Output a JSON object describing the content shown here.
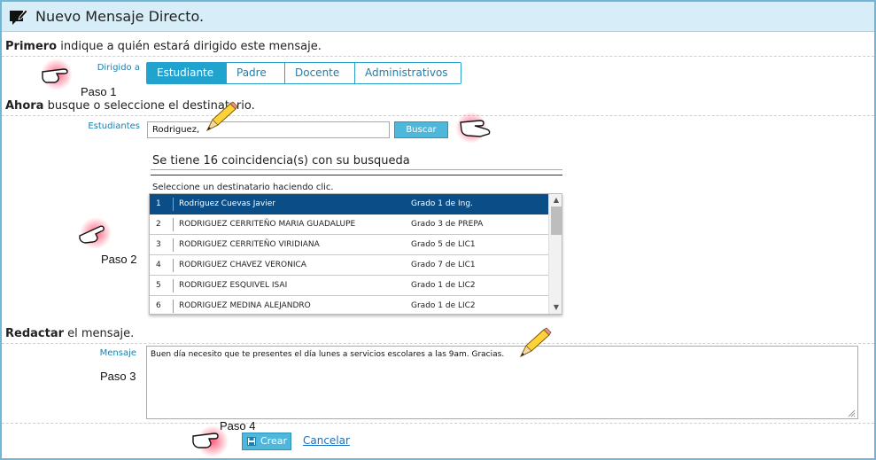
{
  "window": {
    "title": "Nuevo Mensaje Directo.",
    "title_icon": "new-message-icon"
  },
  "section1": {
    "bold": "Primero",
    "rest": " indique a quién estará dirigido este mensaje."
  },
  "recipient_type": {
    "label": "Dirigido a",
    "tabs": [
      {
        "label": "Estudiante",
        "active": true
      },
      {
        "label": "Padre",
        "active": false
      },
      {
        "label": "Docente",
        "active": false
      },
      {
        "label": "Administrativos",
        "active": false
      }
    ]
  },
  "section2": {
    "bold": "Ahora",
    "rest": " busque o seleccione el destinatario."
  },
  "search": {
    "label": "Estudiantes",
    "value": "Rodriguez,",
    "button_label": "Buscar"
  },
  "results": {
    "summary": "Se tiene 16 coincidencia(s) con su busqueda",
    "help": "Seleccione un destinatario haciendo clic.",
    "rows": [
      {
        "num": "1",
        "name": "Rodriguez Cuevas Javier",
        "grade": "Grado 1 de Ing.",
        "selected": true
      },
      {
        "num": "2",
        "name": "RODRIGUEZ CERRITEÑO MARIA GUADALUPE",
        "grade": "Grado 3 de PREPA",
        "selected": false
      },
      {
        "num": "3",
        "name": "RODRIGUEZ CERRITEÑO VIRIDIANA",
        "grade": "Grado 5 de LIC1",
        "selected": false
      },
      {
        "num": "4",
        "name": "RODRIGUEZ CHAVEZ VERONICA",
        "grade": "Grado 7 de LIC1",
        "selected": false
      },
      {
        "num": "5",
        "name": "RODRIGUEZ ESQUIVEL ISAI",
        "grade": "Grado 1 de LIC2",
        "selected": false
      },
      {
        "num": "6",
        "name": "RODRIGUEZ MEDINA ALEJANDRO",
        "grade": "Grado 1 de LIC2",
        "selected": false
      }
    ],
    "scroll_up_glyph": "▲",
    "scroll_down_glyph": "▼"
  },
  "section3": {
    "bold": "Redactar",
    "rest": " el mensaje."
  },
  "message": {
    "label": "Mensaje",
    "value": "Buen día necesito que te presentes el día lunes a servicios escolares a las 9am. Gracias."
  },
  "actions": {
    "create_label": "Crear",
    "cancel_label": "Cancelar"
  },
  "steps": {
    "step1": "Paso 1",
    "step2": "Paso 2",
    "step3": "Paso 3",
    "step4": "Paso 4"
  },
  "colors": {
    "accent": "#21a3cf",
    "selected_row": "#0b4d86",
    "title_bg": "#d7eef8",
    "link": "#1a6fc2",
    "glow": "#ff2a55"
  }
}
